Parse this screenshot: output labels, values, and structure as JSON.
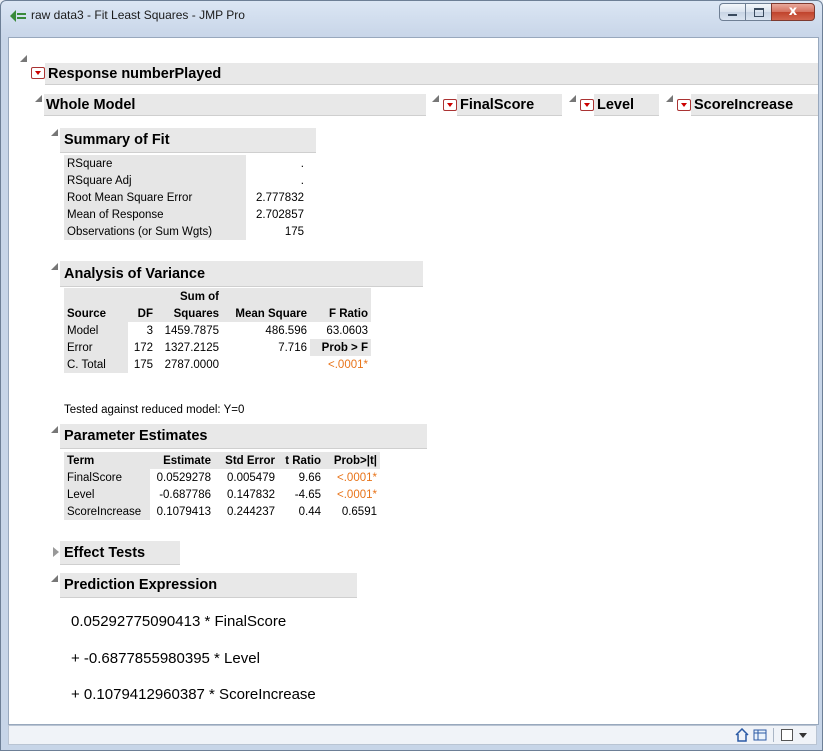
{
  "window": {
    "title": "raw data3 - Fit Least Squares - JMP Pro",
    "close_glyph": "x"
  },
  "response": {
    "title": "Response numberPlayed"
  },
  "whole_model": {
    "title": "Whole Model"
  },
  "side_reports": [
    {
      "title": "FinalScore"
    },
    {
      "title": "Level"
    },
    {
      "title": "ScoreIncrease"
    }
  ],
  "summary_of_fit": {
    "title": "Summary of Fit",
    "rows": [
      {
        "label": "RSquare",
        "value": "."
      },
      {
        "label": "RSquare Adj",
        "value": "."
      },
      {
        "label": "Root Mean Square Error",
        "value": "2.777832"
      },
      {
        "label": "Mean of Response",
        "value": "2.702857"
      },
      {
        "label": "Observations (or Sum Wgts)",
        "value": "175"
      }
    ]
  },
  "anova": {
    "title": "Analysis of Variance",
    "header_top": "Sum of",
    "headers": [
      "Source",
      "DF",
      "Squares",
      "Mean Square",
      "F Ratio"
    ],
    "rows": [
      {
        "source": "Model",
        "df": "3",
        "ss": "1459.7875",
        "ms": "486.596",
        "f": "63.0603"
      },
      {
        "source": "Error",
        "df": "172",
        "ss": "1327.2125",
        "ms": "7.716",
        "f": "Prob > F"
      },
      {
        "source": "C. Total",
        "df": "175",
        "ss": "2787.0000",
        "ms": "",
        "f": "<.0001*"
      }
    ],
    "note": "Tested against reduced model: Y=0"
  },
  "parameter_estimates": {
    "title": "Parameter Estimates",
    "headers": [
      "Term",
      "Estimate",
      "Std Error",
      "t Ratio",
      "Prob>|t|"
    ],
    "rows": [
      {
        "term": "FinalScore",
        "estimate": "0.0529278",
        "std_error": "0.005479",
        "t_ratio": "9.66",
        "prob": "<.0001*"
      },
      {
        "term": "Level",
        "estimate": "-0.687786",
        "std_error": "0.147832",
        "t_ratio": "-4.65",
        "prob": "<.0001*"
      },
      {
        "term": "ScoreIncrease",
        "estimate": "0.1079413",
        "std_error": "0.244237",
        "t_ratio": "0.44",
        "prob": "0.6591"
      }
    ]
  },
  "effect_tests": {
    "title": "Effect Tests"
  },
  "prediction_expression": {
    "title": "Prediction Expression",
    "lines": [
      "0.05292775090413 * FinalScore",
      "+ -0.6877855980395 * Level",
      "+ 0.1079412960387 * ScoreIncrease"
    ]
  },
  "colors": {
    "significant_p": "#e8741a",
    "header_bg": "#e8e8e8",
    "menu_red": "#cc0000"
  }
}
